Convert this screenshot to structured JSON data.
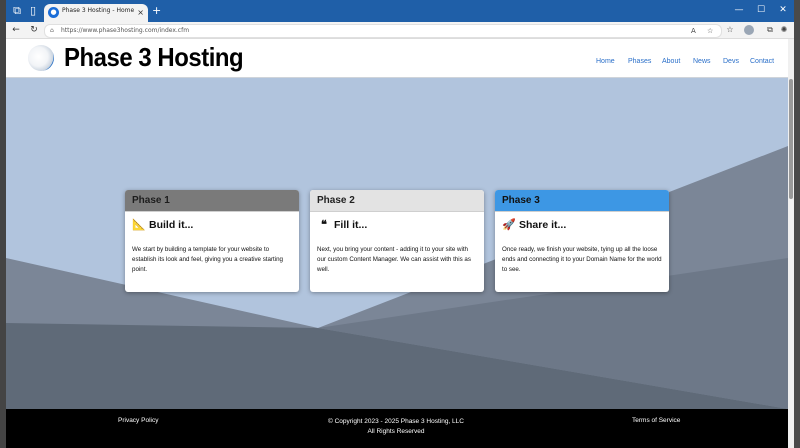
{
  "browser": {
    "tab_title": "Phase 3 Hosting - Home",
    "url": "https://www.phase3hosting.com/index.cfm",
    "tab_close": "×",
    "new_tab": "+",
    "minimize": "—",
    "maximize": "☐",
    "close": "✕",
    "back": "←",
    "refresh": "↻",
    "lock": "⌂",
    "read_aloud": "A",
    "favorite": "☆",
    "favorites_bar": "☆",
    "collections": "⧉",
    "more": "⋯"
  },
  "site": {
    "logo_text": "Phase 3 Hosting",
    "nav": [
      "Home",
      "Phases",
      "About",
      "News",
      "Devs",
      "Contact"
    ]
  },
  "cards": [
    {
      "header": "Phase 1",
      "title": "Build it...",
      "icon": "ruler-icon",
      "glyph": "📐",
      "body": "We start by building a template for your website to establish its look and feel, giving you a creative starting point.",
      "header_color": "#7a7a7a"
    },
    {
      "header": "Phase 2",
      "title": "Fill it...",
      "icon": "quote-lines-icon",
      "glyph": "❝",
      "body": "Next, you bring your content - adding it to your site with our custom Content Manager. We can assist with this as well.",
      "header_color": "#e3e3e3"
    },
    {
      "header": "Phase 3",
      "title": "Share it...",
      "icon": "rocket-icon",
      "glyph": "🚀",
      "body": "Once ready, we finish your website, tying up all the loose ends and connecting it to your Domain Name for the world to see.",
      "header_color": "#3d97e4"
    }
  ],
  "footer": {
    "privacy": "Privacy Policy",
    "copyright": "© Copyright 2023 - 2025 Phase 3 Hosting, LLC",
    "rights": "All Rights Reserved",
    "terms": "Terms of Service"
  },
  "colors": {
    "hero_sky": "#b1c4dd",
    "hero_shape_dark": "#5b6674",
    "hero_shape_mid": "#7a8596",
    "footer": "#000000",
    "nav_link": "#2a6fc9"
  }
}
